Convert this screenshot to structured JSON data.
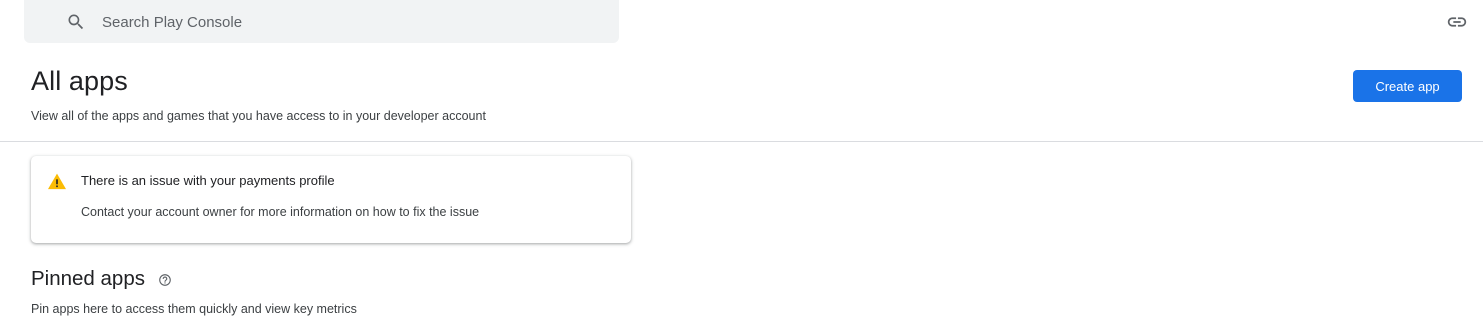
{
  "search": {
    "placeholder": "Search Play Console",
    "icon": "search-icon"
  },
  "toolbar": {
    "link_icon": "link-icon"
  },
  "header": {
    "title": "All apps",
    "subtitle": "View all of the apps and games that you have access to in your developer account",
    "create_button_label": "Create app"
  },
  "alert": {
    "icon": "warning-icon",
    "title": "There is an issue with your payments profile",
    "body": "Contact your account owner for more information on how to fix the issue"
  },
  "pinned": {
    "title": "Pinned apps",
    "help_icon": "help-icon",
    "subtitle": "Pin apps here to access them quickly and view key metrics"
  },
  "colors": {
    "primary": "#1a73e8",
    "warning": "#fbbc04",
    "search_background": "#f1f3f4",
    "divider": "#dadce0"
  }
}
